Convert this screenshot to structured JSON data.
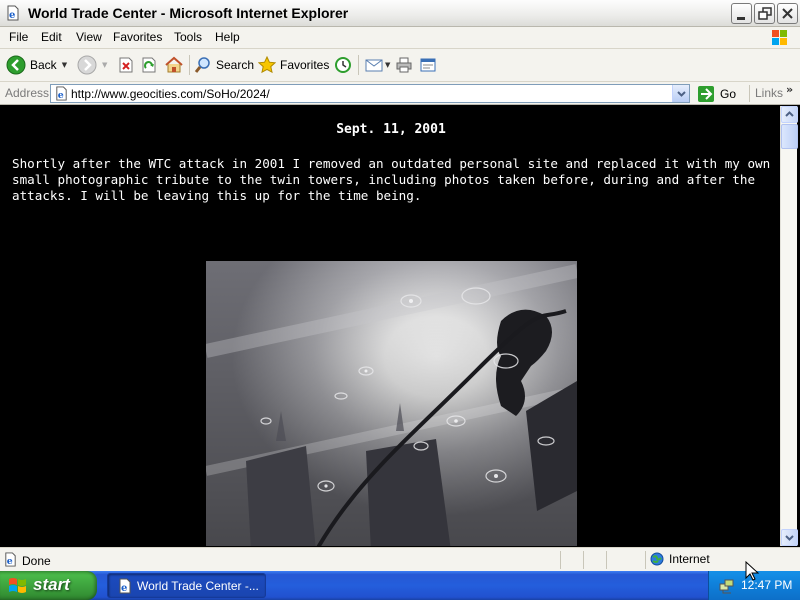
{
  "window": {
    "title": "World Trade Center - Microsoft Internet Explorer",
    "icon": "ie-page-icon"
  },
  "menu": [
    "File",
    "Edit",
    "View",
    "Favorites",
    "Tools",
    "Help"
  ],
  "toolbar": {
    "back_label": "Back",
    "search_label": "Search",
    "favorites_label": "Favorites"
  },
  "address": {
    "label": "Address",
    "url": "http://www.geocities.com/SoHo/2024/",
    "go_label": "Go",
    "links_label": "Links"
  },
  "page": {
    "heading": "Sept. 11, 2001",
    "paragraph": "Shortly after the WTC attack in 2001 I removed an outdated personal site and replaced it with my own small photographic tribute to the twin towers, including photos taken before, during and after the attacks. I will be leaving this up for the time being.",
    "photo_subject": "reflection-of-twin-towers-in-rain-puddle"
  },
  "status": {
    "text": "Done",
    "zone": "Internet"
  },
  "taskbar": {
    "start_label": "start",
    "task_label": "World Trade Center -...",
    "clock": "12:47 PM"
  },
  "colors": {
    "page_background": "#000000",
    "page_text": "#ffffff",
    "taskbar_blue": "#245edc",
    "start_green": "#3c9a3b"
  }
}
